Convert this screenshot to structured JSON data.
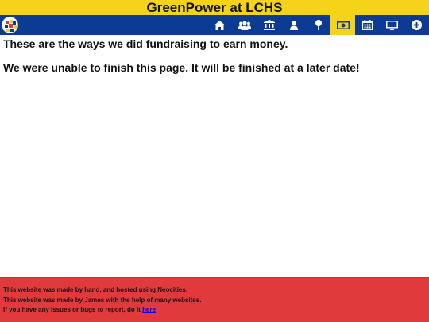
{
  "header": {
    "title": "GreenPower at LCHS"
  },
  "nav": {
    "logo_icon": "team-logo",
    "items": [
      {
        "icon": "home-icon",
        "active": false
      },
      {
        "icon": "team-icon",
        "active": false
      },
      {
        "icon": "school-icon",
        "active": false
      },
      {
        "icon": "person-icon",
        "active": false
      },
      {
        "icon": "pin-icon",
        "active": false
      },
      {
        "icon": "money-icon",
        "active": true
      },
      {
        "icon": "calendar-icon",
        "active": false
      },
      {
        "icon": "monitor-icon",
        "active": false
      },
      {
        "icon": "plus-circle-icon",
        "active": false
      }
    ],
    "colors": {
      "bar": "#0c3b93",
      "active": "#f5d31b",
      "icon": "#ffffff"
    }
  },
  "main": {
    "intro": "These are the ways we did fundraising to earn money.",
    "notice": "We were unable to finish this page. It will be finished at a later date!"
  },
  "footer": {
    "line1": "This website was made by hand, and hosted using Neocities.",
    "line2": "This website was made by James with the help of many websites.",
    "line3_prefix": "If you have any issues or bugs to report, do it ",
    "line3_link": "here"
  }
}
